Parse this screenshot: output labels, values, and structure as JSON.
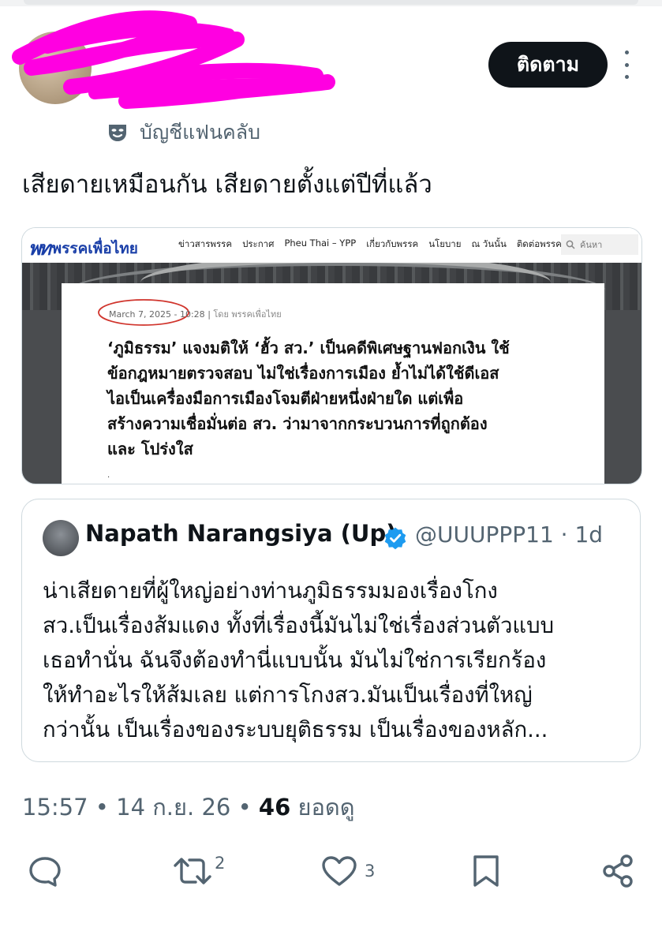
{
  "header": {
    "handle_obscured": "@",
    "follow_label": "ติดตาม",
    "fan_account_label": "บัญชีแฟนคลับ"
  },
  "tweet": {
    "text": "เสียดายเหมือนกัน เสียดายตั้งแต่ปีที่แล้ว",
    "time": "15:57",
    "date": "14 ก.ย. 26",
    "views_count": "46",
    "views_label": "ยอดดู"
  },
  "image": {
    "logo_mark": "พท",
    "logo_text": "พรรคเพื่อไทย",
    "nav_links": [
      "ข่าวสารพรรค",
      "ประกาศ",
      "Pheu Thai – YPP",
      "เกี่ยวกับพรรค",
      "นโยบาย",
      "ณ วันนั้น",
      "ติดต่อพรรค"
    ],
    "search_placeholder": "ค้นหา",
    "article_date": "March 7, 2025 - 10:28",
    "article_by": "โดย พรรคเพื่อไทย",
    "headline_lines": [
      "‘ภูมิธรรม’ แจงมติให้ ‘ฮั้ว สว.’ เป็นคดีพิเศษฐานฟอกเงิน ใช้",
      "ข้อกฎหมายตรวจสอบ ไม่ใช่เรื่องการเมือง ย้ำไม่ได้ใช้ดีเอส",
      "ไอเป็นเครื่องมือการเมืองโจมตีฝ่ายหนึ่งฝ่ายใด แต่เพื่อ",
      "สร้างความเชื่อมั่นต่อ สว. ว่ามาจากกระบวนการที่ถูกต้อง",
      "และ โปร่งใส"
    ],
    "trailing_mark": "."
  },
  "quote": {
    "name": "Napath Narangsiya (Up)",
    "handle": "@UUUPPP11",
    "age": "1d",
    "body_lines": [
      "น่าเสียดายที่ผู้ใหญ่อย่างท่านภูมิธรรมมองเรื่องโกง",
      "สว.เป็นเรื่องส้มแดง ทั้งที่เรื่องนี้มันไม่ใช่เรื่องส่วนตัวแบบ",
      "เธอทำนั่น ฉันจึงต้องทำนี่แบบนั้น มันไม่ใช่การเรียกร้อง",
      "ให้ทำอะไรให้ส้มเลย แต่การโกงสว.มันเป็นเรื่องที่ใหญ่",
      "กว่านั้น เป็นเรื่องของระบบยุติธรรม เป็นเรื่องของหลัก..."
    ]
  },
  "actions": {
    "reply_icon": "reply-icon",
    "retweet_icon": "retweet-icon",
    "retweet_count": "2",
    "like_icon": "heart-icon",
    "like_count": "3",
    "bookmark_icon": "bookmark-icon",
    "share_icon": "share-icon"
  },
  "colors": {
    "text_primary": "#0f1419",
    "text_secondary": "#536471",
    "border": "#cfd9de",
    "verified_blue": "#1d9bf0",
    "scribble_magenta": "#ff00e1",
    "party_blue": "#1a3fa8",
    "annotation_red": "#d0342c"
  }
}
